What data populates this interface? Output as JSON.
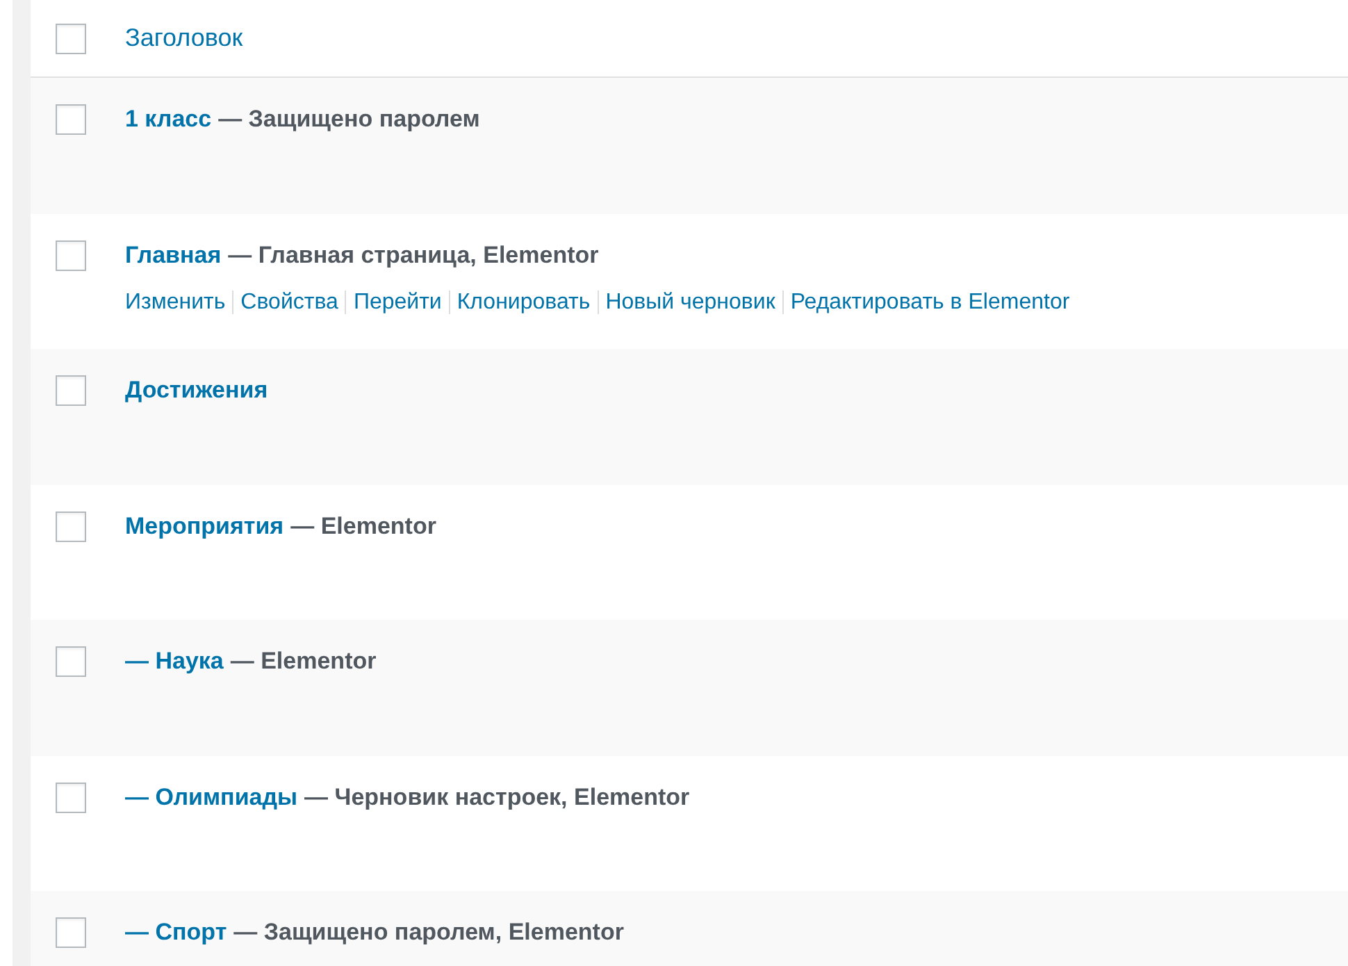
{
  "table": {
    "header": {
      "label": "Заголовок",
      "checked": false
    },
    "rows": [
      {
        "title": "1 класс",
        "state": "— Защищено паролем",
        "checked": false
      },
      {
        "title": "Главная",
        "state": "— Главная страница, Elementor",
        "checked": false,
        "actions": [
          "Изменить",
          "Свойства",
          "Перейти",
          "Клонировать",
          "Новый черновик",
          "Редактировать в Elementor"
        ]
      },
      {
        "title": "Достижения",
        "checked": false
      },
      {
        "title": "Мероприятия",
        "state": "— Elementor",
        "checked": false
      },
      {
        "title": "— Наука",
        "state": "— Elementor",
        "checked": false
      },
      {
        "title": "— Олимпиады",
        "state": "— Черновик настроек, Elementor",
        "checked": false
      },
      {
        "title": "— Спорт",
        "state": "— Защищено паролем, Elementor",
        "checked": false
      }
    ]
  }
}
